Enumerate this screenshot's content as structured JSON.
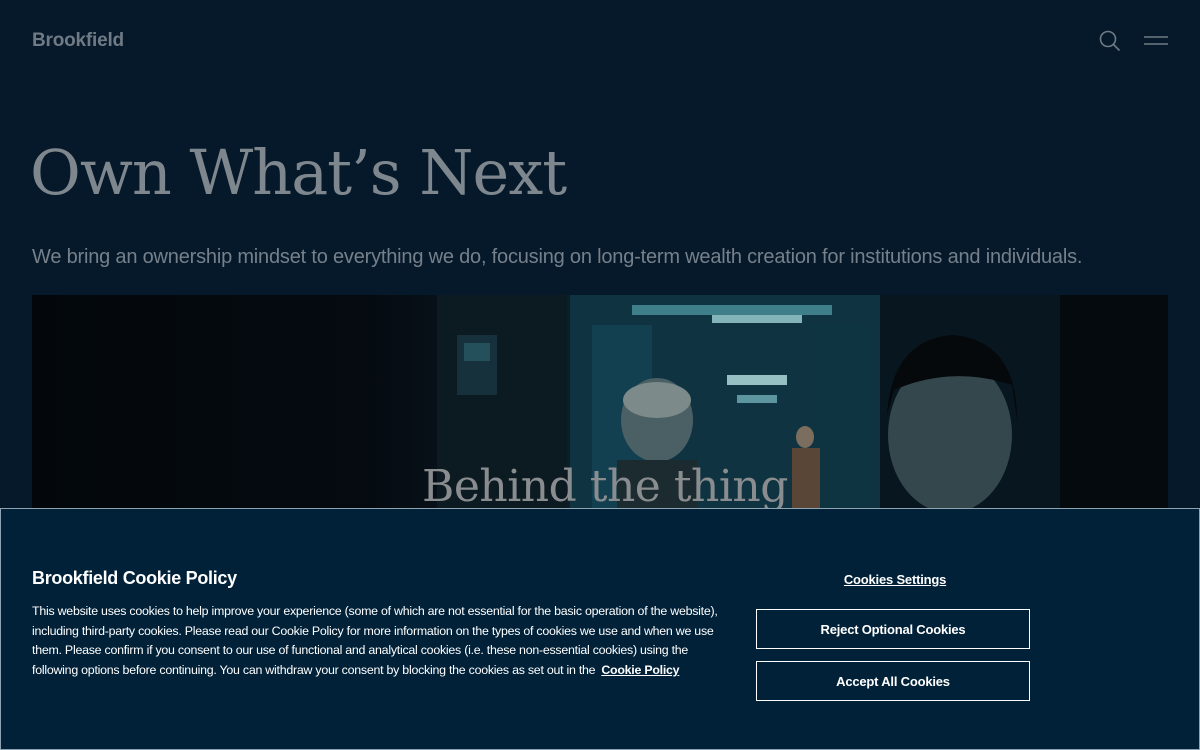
{
  "header": {
    "logo": "Brookfield",
    "search_icon": "search-icon",
    "menu_icon": "hamburger-menu-icon"
  },
  "hero": {
    "title": "Own What’s Next",
    "subtitle": "We bring an ownership mindset to everything we do, focusing on long-term wealth creation for institutions and individuals."
  },
  "video": {
    "caption": "Behind the thing"
  },
  "cookie_banner": {
    "title": "Brookfield Cookie Policy",
    "body": "This website uses cookies to help improve your experience (some of which are not essential for the basic operation of the website), including third-party cookies. Please read our Cookie Policy for more information on the types of cookies we use and when we use them. Please confirm if you consent to our use of functional and analytical cookies (i.e. these non-essential cookies) using the following options before continuing. You can withdraw your consent by blocking the cookies as set out in the",
    "policy_link": "Cookie Policy",
    "settings_label": "Cookies Settings",
    "reject_label": "Reject Optional Cookies",
    "accept_label": "Accept All Cookies",
    "background_color": "#002138"
  }
}
